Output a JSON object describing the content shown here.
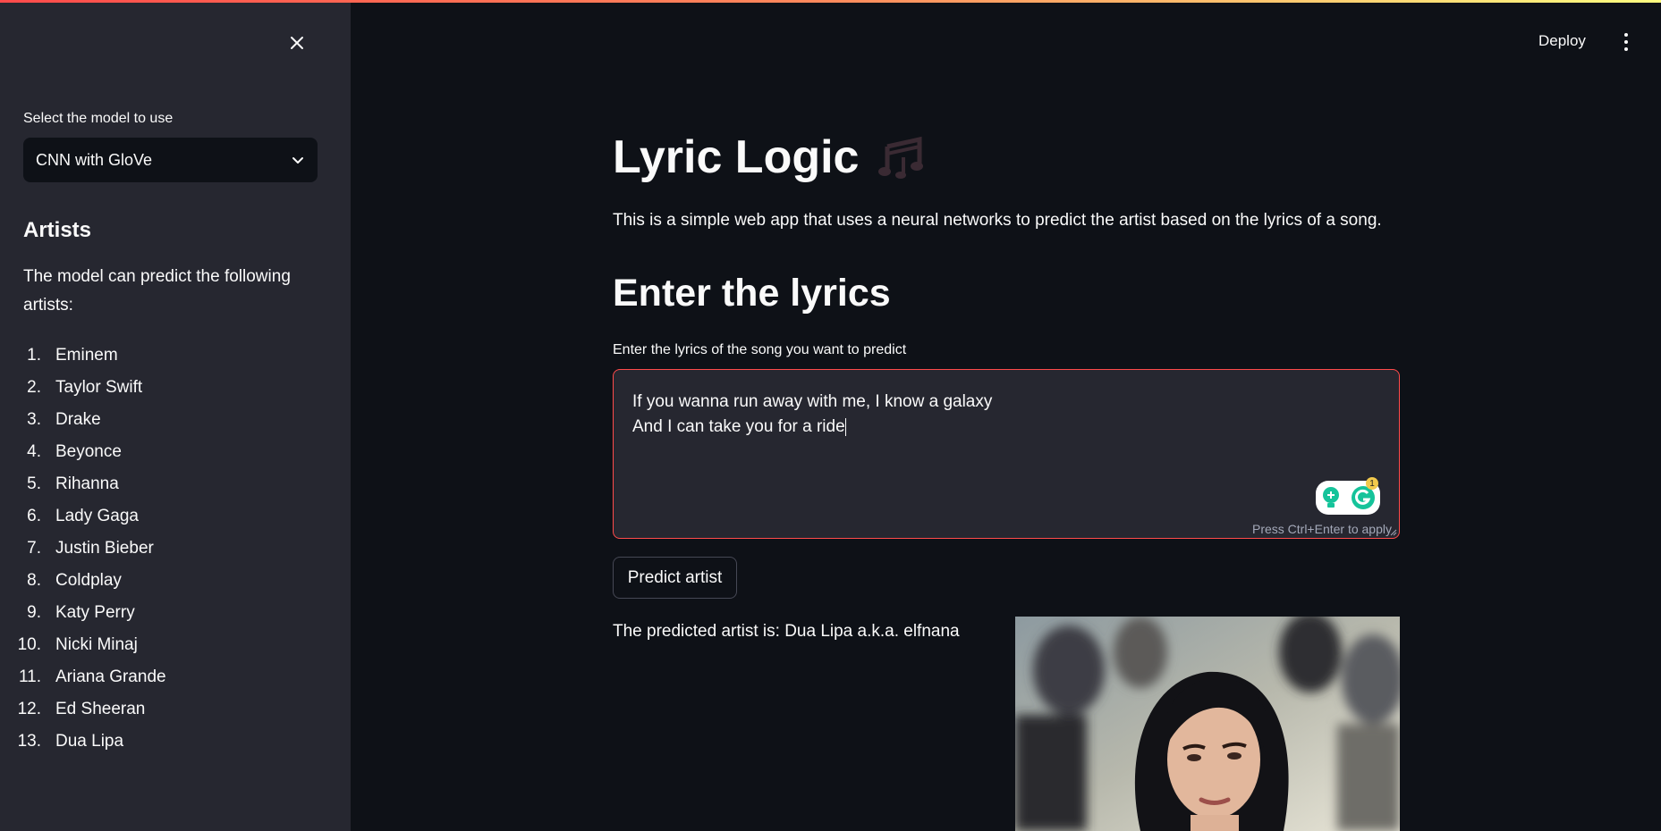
{
  "header": {
    "deploy_label": "Deploy"
  },
  "sidebar": {
    "select_label": "Select the model to use",
    "selected_model": "CNN with GloVe",
    "artists_heading": "Artists",
    "artists_description": "The model can predict the following artists:",
    "artists": [
      {
        "num": "1.",
        "name": "Eminem"
      },
      {
        "num": "2.",
        "name": "Taylor Swift"
      },
      {
        "num": "3.",
        "name": "Drake"
      },
      {
        "num": "4.",
        "name": "Beyonce"
      },
      {
        "num": "5.",
        "name": "Rihanna"
      },
      {
        "num": "6.",
        "name": "Lady Gaga"
      },
      {
        "num": "7.",
        "name": "Justin Bieber"
      },
      {
        "num": "8.",
        "name": "Coldplay"
      },
      {
        "num": "9.",
        "name": "Katy Perry"
      },
      {
        "num": "10.",
        "name": "Nicki Minaj"
      },
      {
        "num": "11.",
        "name": "Ariana Grande"
      },
      {
        "num": "12.",
        "name": "Ed Sheeran"
      },
      {
        "num": "13.",
        "name": "Dua Lipa"
      }
    ]
  },
  "main": {
    "title": "Lyric Logic",
    "intro": "This is a simple web app that uses a neural networks to predict the artist based on the lyrics of a song.",
    "lyrics_heading": "Enter the lyrics",
    "lyrics_label": "Enter the lyrics of the song you want to predict",
    "lyrics_line1": "If you wanna run away with me, I know a galaxy",
    "lyrics_line2": "And I can take you for a ride",
    "hint": "Press Ctrl+Enter to apply",
    "grammarly_count": "1",
    "predict_label": "Predict artist",
    "result": "The predicted artist is: Dua Lipa a.k.a. elfnana"
  },
  "colors": {
    "background": "#0e1117",
    "sidebar": "#262730",
    "accent": "#ff4b4b",
    "text": "#fafafa"
  }
}
